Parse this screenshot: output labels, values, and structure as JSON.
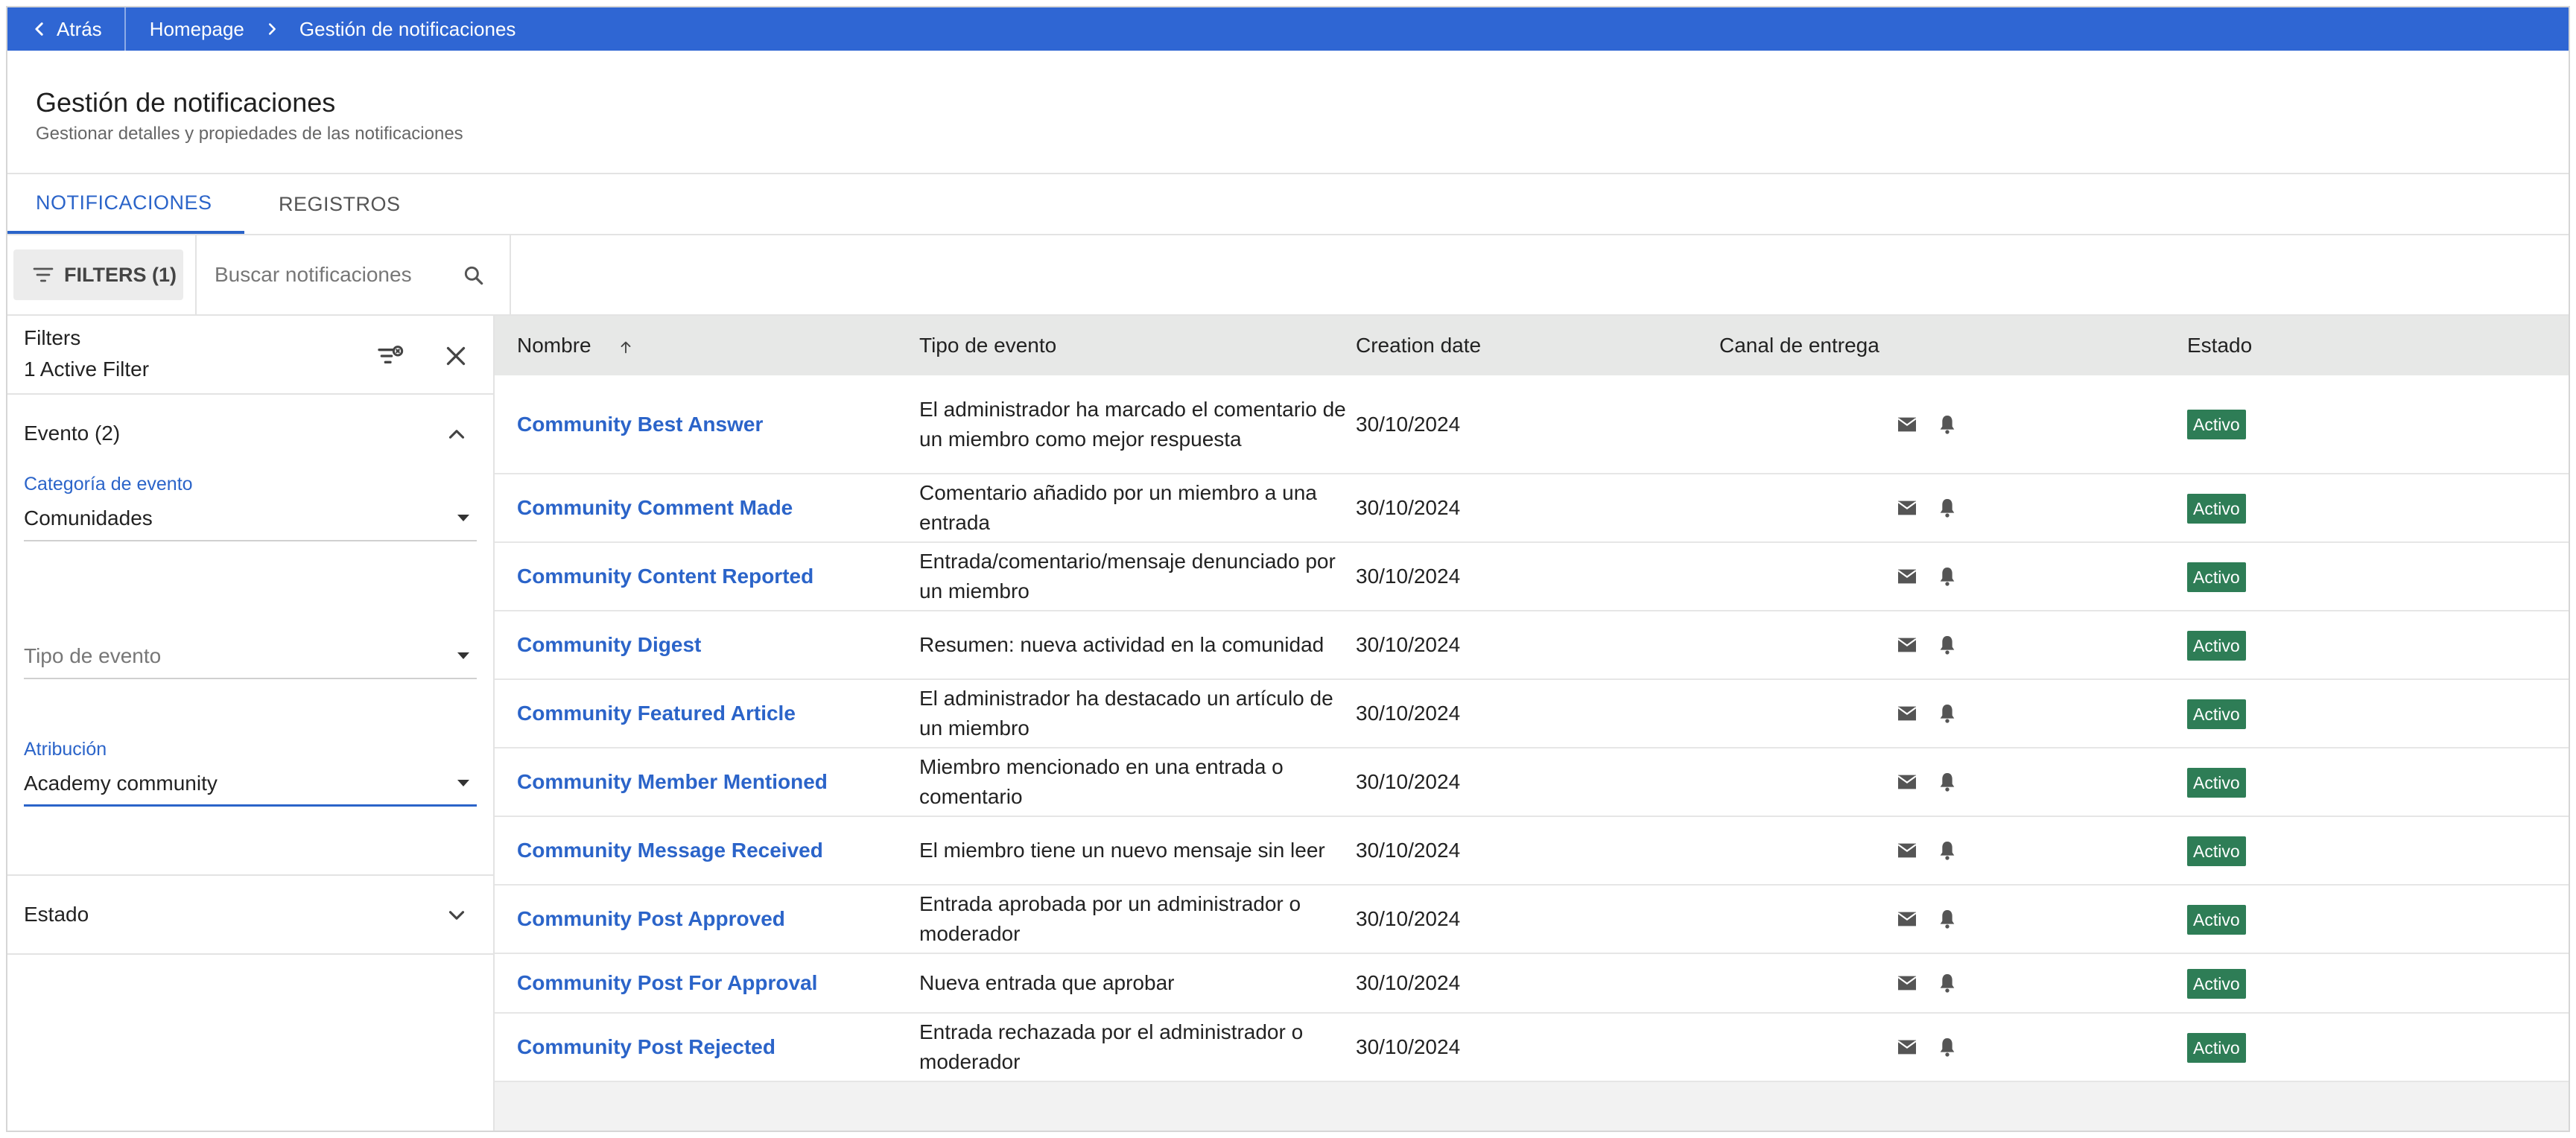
{
  "topbar": {
    "back_label": "Atrás",
    "breadcrumb": [
      "Homepage",
      "Gestión de notificaciones"
    ]
  },
  "header": {
    "title": "Gestión de notificaciones",
    "subtitle": "Gestionar detalles y propiedades de las notificaciones"
  },
  "tabs": [
    {
      "label": "NOTIFICACIONES",
      "active": true
    },
    {
      "label": "REGISTROS",
      "active": false
    }
  ],
  "toolbar": {
    "filters_label": "FILTERS (1)",
    "search_placeholder": "Buscar notificaciones",
    "search_value": ""
  },
  "filter_panel": {
    "title": "Filters",
    "active_count": "1 Active Filter",
    "sections": {
      "evento": {
        "label": "Evento (2)",
        "expanded": true,
        "fields": {
          "categoria": {
            "label": "Categoría de evento",
            "value": "Comunidades"
          },
          "tipo": {
            "label": "",
            "placeholder": "Tipo de evento",
            "value": ""
          },
          "atribucion": {
            "label": "Atribución",
            "value": "Academy community"
          }
        }
      },
      "estado": {
        "label": "Estado",
        "expanded": false
      }
    }
  },
  "table": {
    "columns": [
      "Nombre",
      "Tipo de evento",
      "Creation date",
      "Canal de entrega",
      "Estado"
    ],
    "sort": {
      "column": "Nombre",
      "direction": "asc"
    },
    "rows": [
      {
        "name": "Community Best Answer",
        "desc": "El administrador ha marcado el comentario de un miembro como mejor respuesta",
        "date": "30/10/2024",
        "channels": [
          "email-icon",
          "bell-icon"
        ],
        "status": "Activo"
      },
      {
        "name": "Community Comment Made",
        "desc": "Comentario añadido por un miembro a una entrada",
        "date": "30/10/2024",
        "channels": [
          "email-icon",
          "bell-icon"
        ],
        "status": "Activo"
      },
      {
        "name": "Community Content Reported",
        "desc": "Entrada/comentario/mensaje denunciado por un miembro",
        "date": "30/10/2024",
        "channels": [
          "email-icon",
          "bell-icon"
        ],
        "status": "Activo"
      },
      {
        "name": "Community Digest",
        "desc": "Resumen: nueva actividad en la comunidad",
        "date": "30/10/2024",
        "channels": [
          "email-icon",
          "bell-icon"
        ],
        "status": "Activo"
      },
      {
        "name": "Community Featured Article",
        "desc": "El administrador ha destacado un artículo de un miembro",
        "date": "30/10/2024",
        "channels": [
          "email-icon",
          "bell-icon"
        ],
        "status": "Activo"
      },
      {
        "name": "Community Member Mentioned",
        "desc": "Miembro mencionado en una entrada o comentario",
        "date": "30/10/2024",
        "channels": [
          "email-icon",
          "bell-icon"
        ],
        "status": "Activo"
      },
      {
        "name": "Community Message Received",
        "desc": "El miembro tiene un nuevo mensaje sin leer",
        "date": "30/10/2024",
        "channels": [
          "email-icon",
          "bell-icon"
        ],
        "status": "Activo"
      },
      {
        "name": "Community Post Approved",
        "desc": "Entrada aprobada por un administrador o moderador",
        "date": "30/10/2024",
        "channels": [
          "email-icon",
          "bell-icon"
        ],
        "status": "Activo"
      },
      {
        "name": "Community Post For Approval",
        "desc": "Nueva entrada que aprobar",
        "date": "30/10/2024",
        "channels": [
          "email-icon",
          "bell-icon"
        ],
        "status": "Activo"
      },
      {
        "name": "Community Post Rejected",
        "desc": "Entrada rechazada por el administrador o moderador",
        "date": "30/10/2024",
        "channels": [
          "email-icon",
          "bell-icon"
        ],
        "status": "Activo"
      }
    ]
  },
  "colors": {
    "topbar": "#2f66d3",
    "link": "#2b64c9",
    "status_active": "#2e7d56",
    "header_row": "#e7e8e7"
  }
}
